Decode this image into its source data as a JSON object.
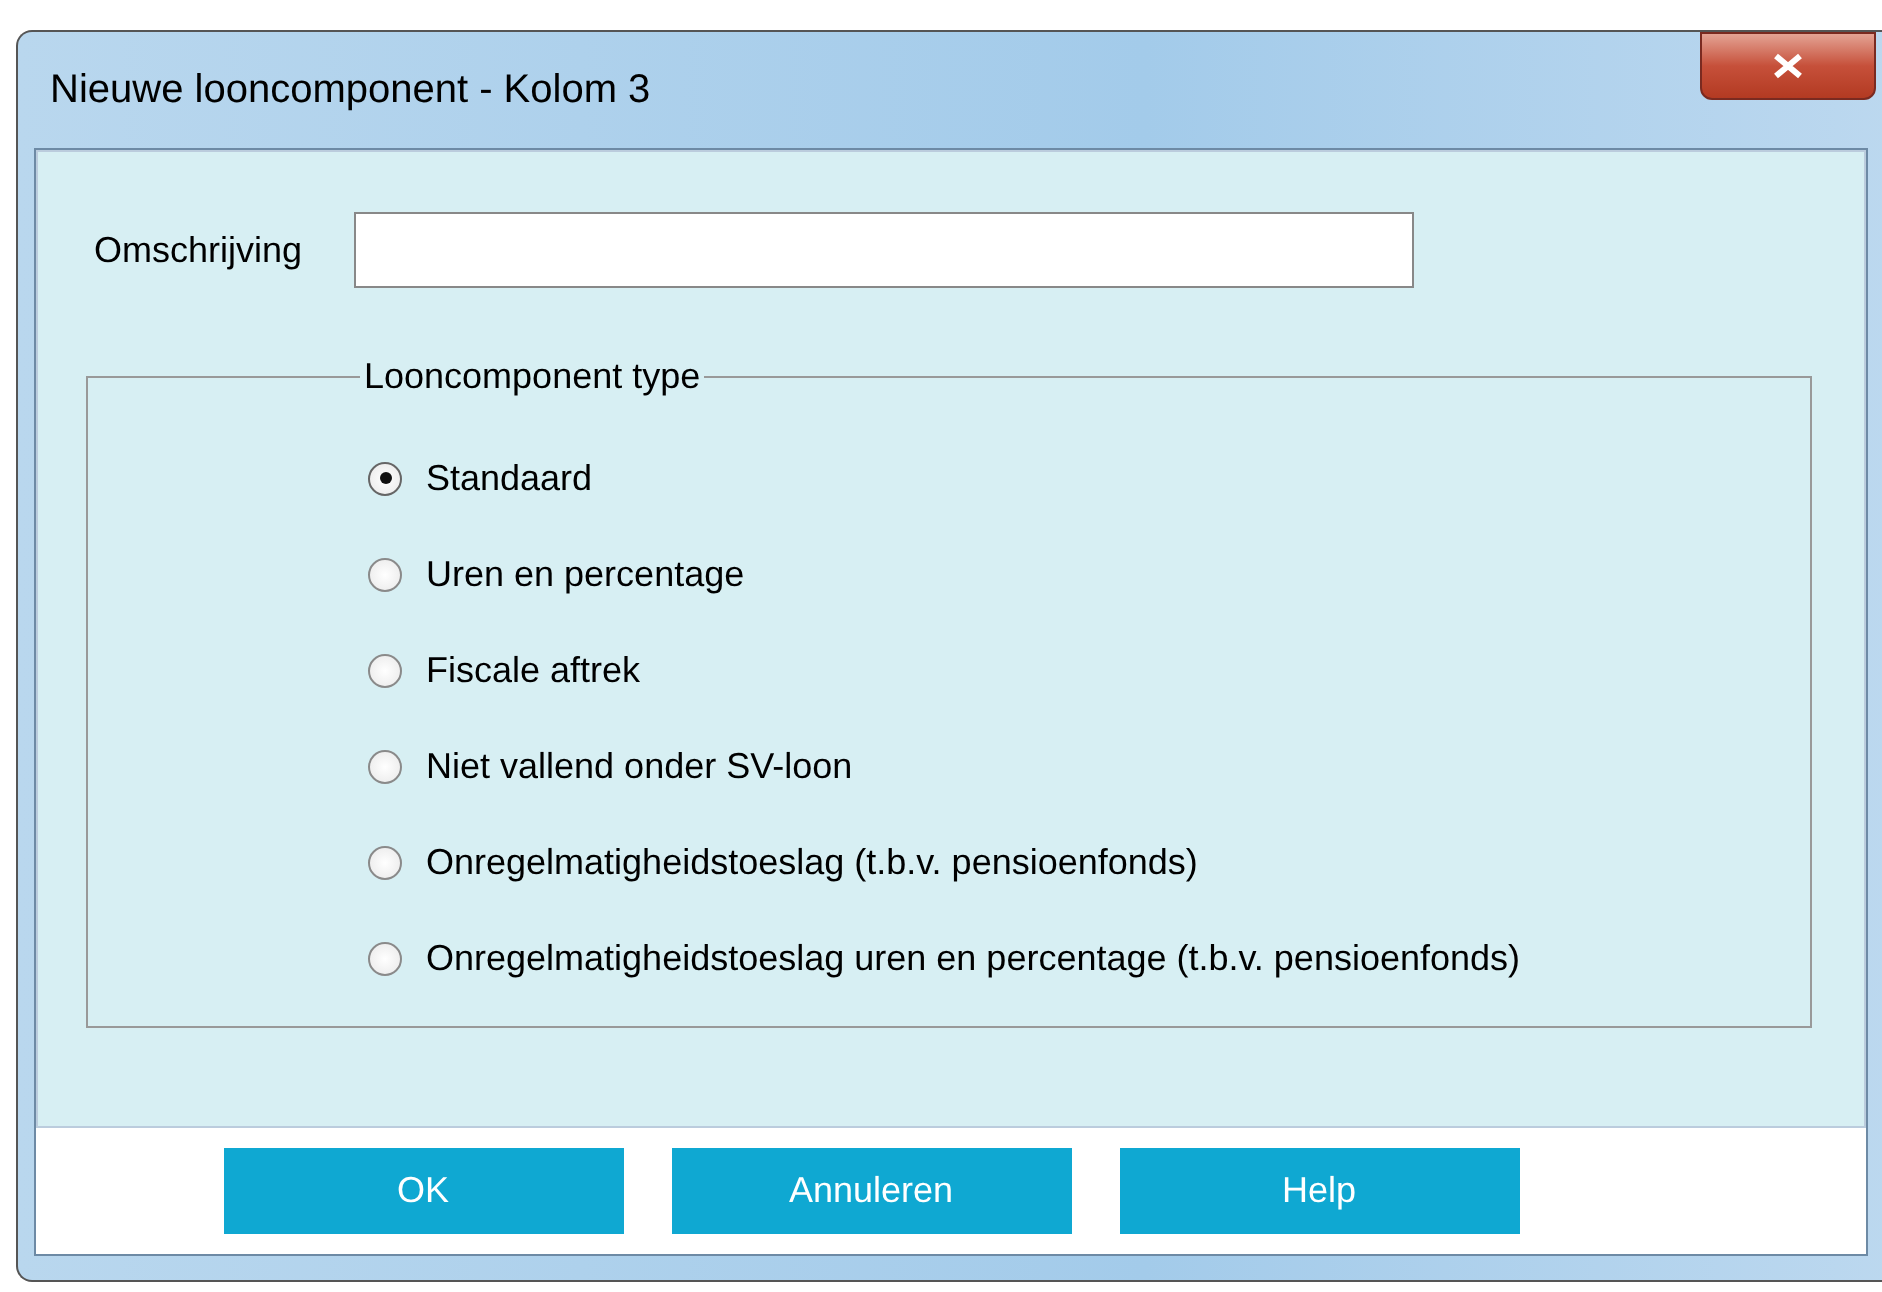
{
  "window": {
    "title": "Nieuwe looncomponent - Kolom 3"
  },
  "description_field": {
    "label": "Omschrijving"
  },
  "type_group": {
    "legend": "Looncomponent type",
    "options": [
      {
        "label": "Standaard",
        "selected": true
      },
      {
        "label": "Uren en percentage",
        "selected": false
      },
      {
        "label": "Fiscale aftrek",
        "selected": false
      },
      {
        "label": "Niet vallend onder SV-loon",
        "selected": false
      },
      {
        "label": "Onregelmatigheidstoeslag (t.b.v. pensioenfonds)",
        "selected": false
      },
      {
        "label": "Onregelmatigheidstoeslag uren en percentage (t.b.v. pensioenfonds)",
        "selected": false
      }
    ]
  },
  "buttons": [
    "OK",
    "Annuleren",
    "Help"
  ]
}
